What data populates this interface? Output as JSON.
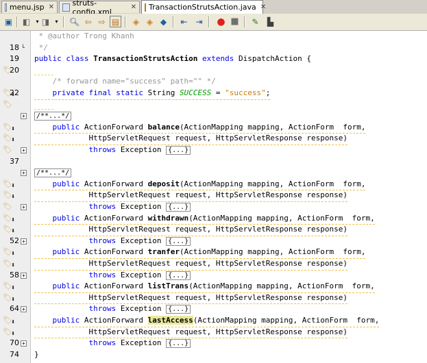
{
  "tabs": [
    {
      "label": "menu.jsp",
      "active": false
    },
    {
      "label": "struts-config.xml",
      "active": false
    },
    {
      "label": "TransactionStrutsAction.java",
      "active": true
    }
  ],
  "toolbar_icons": [
    "source-history-icon",
    "back-icon",
    "forward-icon",
    "find-icon",
    "find-previous-icon",
    "find-next-icon",
    "toggle-highlight-icon",
    "previous-bookmark-icon",
    "next-bookmark-icon",
    "toggle-bookmark-icon",
    "shift-left-icon",
    "shift-right-icon",
    "start-macro-icon",
    "stop-macro-icon",
    "comment-icon",
    "uncomment-icon"
  ],
  "code": {
    "line_18": {
      "num": "18",
      "text": " * @author Trong Khanh"
    },
    "line_19": {
      "num": "19",
      "text": " */"
    },
    "line_20": {
      "num": "20",
      "kw1": "public class ",
      "name": "TransactionStrutsAction",
      "kw2": " extends ",
      "rest": "DispatchAction {"
    },
    "line_22": {
      "num": "22",
      "text": "    /* forward name=\"success\" path=\"\" */"
    },
    "line_sx": {
      "kw": "    private final static ",
      "type": "String ",
      "const": "SUCCESS",
      "eq": " = ",
      "str": "\"success\"",
      "end": ";"
    },
    "fold_comment": "/**...*/",
    "fold_body": "{...}",
    "throws": "throws",
    "exception": " Exception ",
    "sig_prefix": "public ",
    "ret_type": "ActionForward ",
    "params1": "(ActionMapping mapping, ActionForm  form,",
    "params2": "HttpServletRequest request, HttpServletResponse response)",
    "methods": [
      "balance",
      "deposit",
      "withdrawn",
      "tranfer",
      "listTrans",
      "lastAccess"
    ],
    "line_37": "37",
    "line_52": "52",
    "line_58": "58",
    "line_64": "64",
    "line_70": "70",
    "line_74": {
      "num": "74",
      "text": "}"
    }
  }
}
